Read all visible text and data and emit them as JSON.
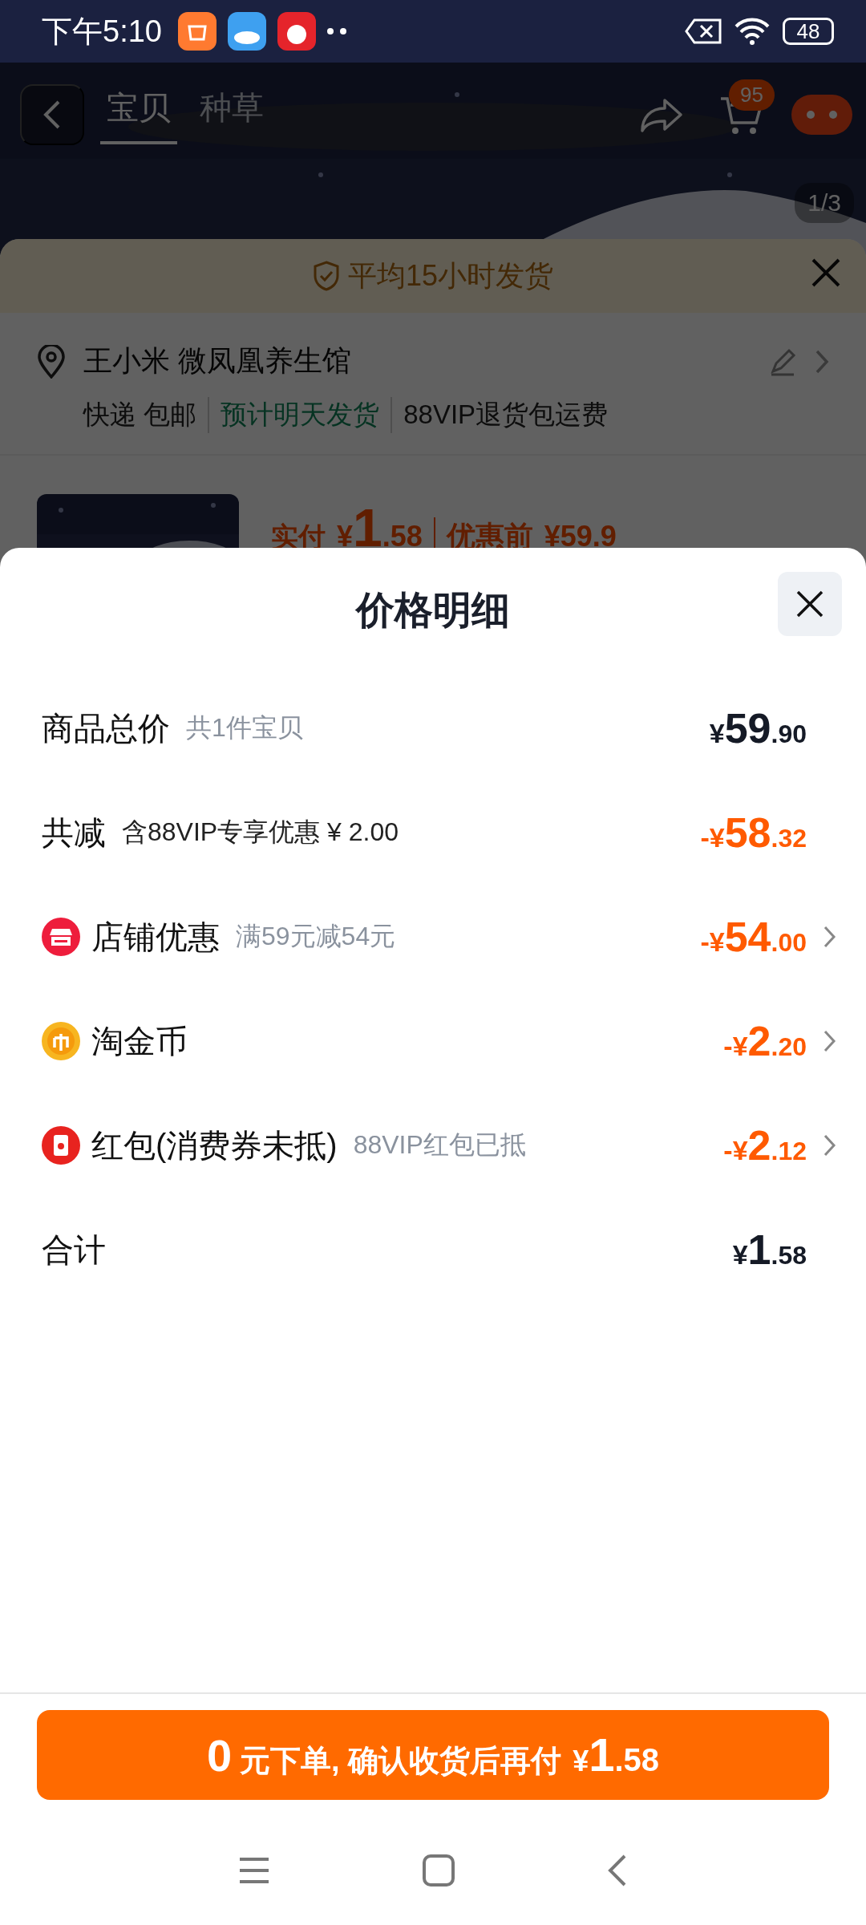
{
  "status_bar": {
    "time": "下午5:10",
    "battery": "48"
  },
  "header": {
    "tabs": [
      {
        "label": "宝贝",
        "selected": true
      },
      {
        "label": "种草",
        "selected": false
      }
    ],
    "cart_badge": "95",
    "image_counter": "1/3"
  },
  "order_sheet": {
    "shipping_note": "平均15小时发货",
    "address": "王小米 微凤凰养生馆",
    "delivery": [
      {
        "text": "快递 包邮",
        "kind": "plain"
      },
      {
        "text": "预计明天发货",
        "kind": "highlight"
      },
      {
        "text": "88VIP退货包运费",
        "kind": "plain"
      }
    ],
    "paid_label": "实付",
    "paid_currency": "¥",
    "paid_int": "1",
    "paid_dec": ".58",
    "before_label": "优惠前",
    "before_price": "¥59.9"
  },
  "price_detail": {
    "title": "价格明细",
    "rows": [
      {
        "label": "商品总价",
        "note": "共1件宝贝",
        "kind": "sum",
        "prefix": "¥",
        "int": "59",
        "dec": ".90",
        "arrow": false
      },
      {
        "label": "共减",
        "note": "含88VIP专享优惠 ¥ 2.00",
        "kind": "reduction",
        "prefix": "-¥",
        "int": "58",
        "dec": ".32",
        "arrow": false
      },
      {
        "label": "店铺优惠",
        "note": "满59元减54元",
        "kind": "shop",
        "prefix": "-¥",
        "int": "54",
        "dec": ".00",
        "arrow": true
      },
      {
        "label": "淘金币",
        "kind": "coin",
        "prefix": "-¥",
        "int": "2",
        "dec": ".20",
        "arrow": true
      },
      {
        "label": "红包(消费券未抵)",
        "note": "88VIP红包已抵",
        "kind": "envelope",
        "prefix": "-¥",
        "int": "2",
        "dec": ".12",
        "arrow": true
      },
      {
        "label": "合计",
        "kind": "total",
        "prefix": "¥",
        "int": "1",
        "dec": ".58",
        "arrow": false
      }
    ]
  },
  "submit_button": {
    "lead": "0",
    "text": "元下单, 确认收货后再付",
    "currency": "¥",
    "int": "1",
    "dec": ".58"
  }
}
